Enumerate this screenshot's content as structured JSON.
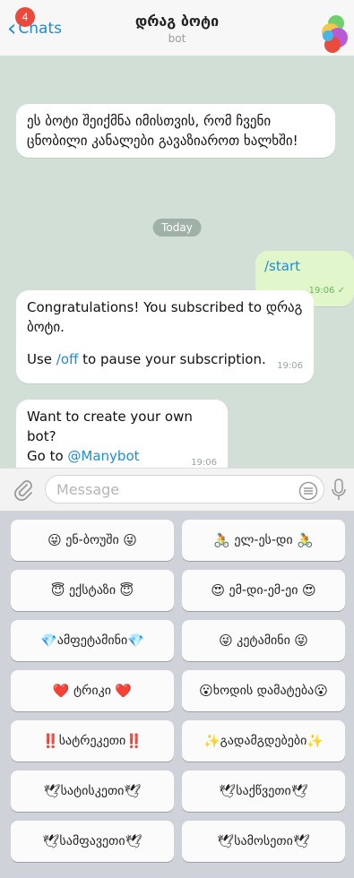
{
  "header": {
    "back_label": "Chats",
    "unread_count": "4",
    "title": "დრაგ ბოტი",
    "subtitle": "bot"
  },
  "chat": {
    "intro_message": "ეს ბოტი შეიქმნა იმისთვის, რომ ჩვენი ცნობილი კანალები გავაზიაროთ ხალხში!",
    "date_label": "Today",
    "outgoing_text": "/start",
    "outgoing_time": "19:06",
    "congrats_line1": "Congratulations! You subscribed to დრაგ ბოტი.",
    "congrats_line2_prefix": "Use ",
    "congrats_command": "/off",
    "congrats_line2_suffix": " to pause your subscription.",
    "congrats_time": "19:06",
    "promo_line1": "Want to create your own bot?",
    "promo_line2_prefix": "Go to ",
    "promo_link": "@Manybot",
    "promo_time": "19:06"
  },
  "composer": {
    "placeholder": "Message"
  },
  "keyboard": {
    "buttons": [
      {
        "left": "😜",
        "label": "ენ-ბოუში",
        "right": "😜"
      },
      {
        "left": "🚴",
        "label": "ელ-ეს-დი",
        "right": "🚴"
      },
      {
        "left": "😇",
        "label": "ექსტაზი",
        "right": "😇"
      },
      {
        "left": "😍",
        "label": "ემ-დი-ემ-ეი",
        "right": "😍"
      },
      {
        "left": "💎",
        "label": "ამფეტამინი",
        "right": "💎"
      },
      {
        "left": "😜",
        "label": "კეტამინი",
        "right": "😜"
      },
      {
        "left": "❤️",
        "label": "ტრიკი",
        "right": "❤️"
      },
      {
        "left": "😮",
        "label": "ხოდის დამატება",
        "right": "😮"
      },
      {
        "left": "‼️",
        "label": "სატრეკეთი",
        "right": "‼️"
      },
      {
        "left": "✨",
        "label": "გადამგდებები",
        "right": "✨"
      },
      {
        "left": "🕊",
        "label": "სატისკეთი",
        "right": "🕊"
      },
      {
        "left": "🕊",
        "label": "საქწვეთი",
        "right": "🕊"
      },
      {
        "left": "🕊",
        "label": "სამფავეთი",
        "right": "🕊"
      },
      {
        "left": "🕊",
        "label": "სამოსეთი",
        "right": "🕊"
      }
    ]
  },
  "colors": {
    "accent": "#1f8bd6",
    "chat_bg": "#d1dfd6",
    "outgoing_bubble": "#e1f7cb",
    "badge": "#e84a3c"
  }
}
